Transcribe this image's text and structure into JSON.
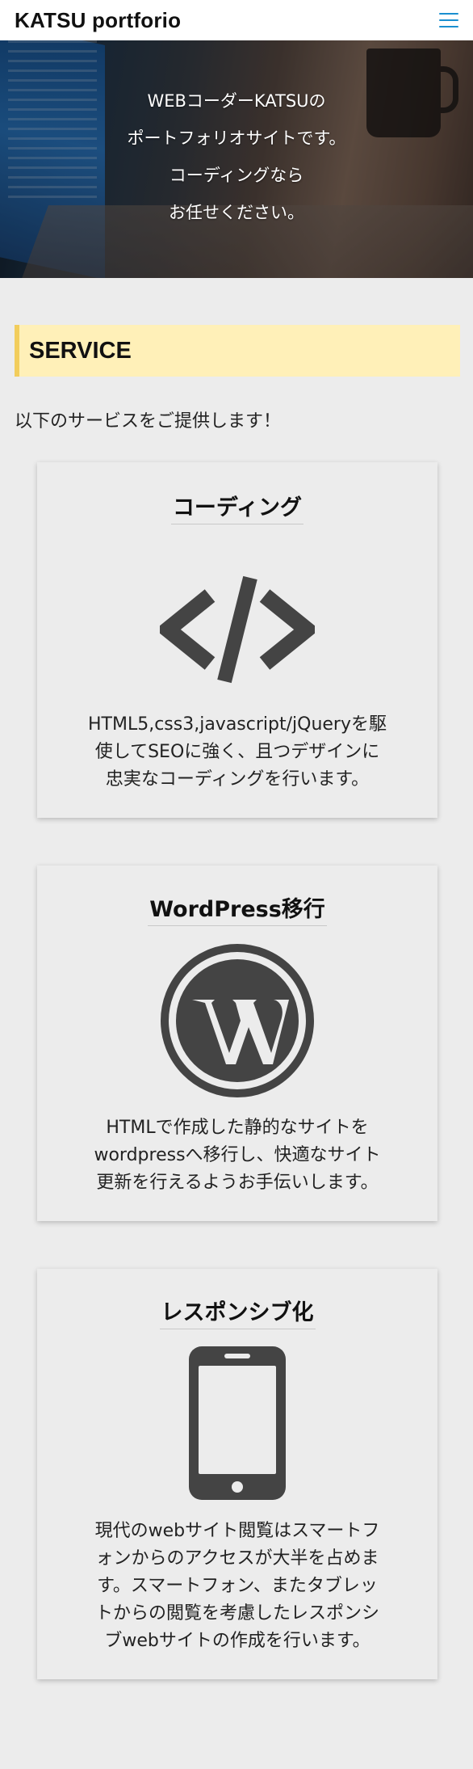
{
  "header": {
    "site_title": "KATSU portforio",
    "menu_icon": "hamburger-menu-icon"
  },
  "hero": {
    "lines": [
      "WEBコーダーKATSUの",
      "ポートフォリオサイトです。",
      "コーディングなら",
      "お任せください。"
    ]
  },
  "service": {
    "heading": "SERVICE",
    "intro": "以下のサービスをご提供します！",
    "cards": [
      {
        "title": "コーディング",
        "icon": "code-icon",
        "description": [
          "HTML5,css3,javascript/jQueryを駆",
          "使してSEOに強く、且つデザインに",
          "忠実なコーディングを行います。"
        ]
      },
      {
        "title": "WordPress移行",
        "icon": "wordpress-icon",
        "description": [
          "HTMLで作成した静的なサイトを",
          "wordpressへ移行し、快適なサイト",
          "更新を行えるようお手伝いします。"
        ]
      },
      {
        "title": "レスポンシブ化",
        "icon": "smartphone-icon",
        "description": [
          "現代のwebサイト閲覧はスマートフ",
          "ォンからのアクセスが大半を占めま",
          "す。スマートフォン、またタブレッ",
          "トからの閲覧を考慮したレスポンシ",
          "ブwebサイトの作成を行います。"
        ]
      }
    ]
  },
  "colors": {
    "accent": "#1a8fd0",
    "heading_bg": "#fff0b8",
    "heading_border": "#f2cd5c",
    "icon": "#444444",
    "page_bg": "#ececec"
  }
}
